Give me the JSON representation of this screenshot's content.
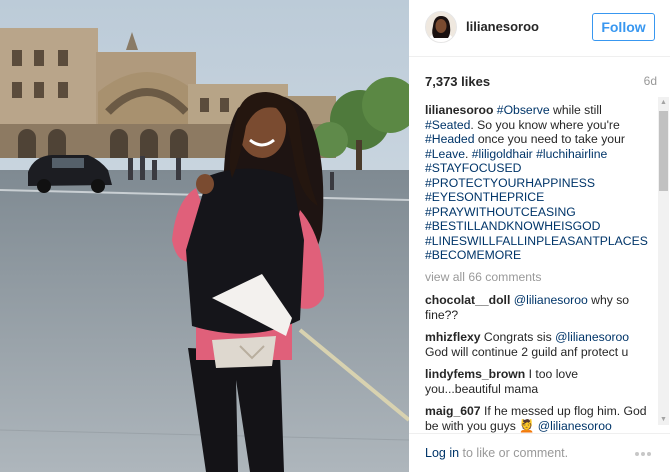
{
  "post": {
    "username": "lilianesoroo",
    "follow_label": "Follow",
    "likes": "7,373 likes",
    "time": "6d",
    "caption": {
      "user": "lilianesoroo",
      "t1": "#Observe",
      "t2": " while still ",
      "t3": "#Seated",
      "t4": ". So you know where you're ",
      "t5": "#Headed",
      "t6": " once you need to take your ",
      "t7": "#Leave",
      "t8": ". ",
      "t9": "#liligoldhair",
      "t10": " ",
      "t11": "#luchihairline",
      "tags": [
        "#STAYFOCUSED",
        "#PROTECTYOURHAPPINESS",
        "#EYESONTHEPRICE",
        "#PRAYWITHOUTCEASING",
        "#BESTILLANDKNOWHEISGOD",
        "#LINESWILLFALLINPLEASANTPLACES",
        "#BECOMEMORE"
      ]
    },
    "view_all": "view all 66 comments",
    "comments": [
      {
        "user": "chocolat__doll",
        "mention": "@lilianesoroo",
        "text": " why so fine??"
      },
      {
        "user": "mhizflexy",
        "pre": " Congrats sis ",
        "mention": "@lilianesoroo",
        "text": " God will continue 2 guild anf protect u"
      },
      {
        "user": "lindyfems_brown",
        "text": " I too love you...beautiful mama"
      },
      {
        "user": "maig_607",
        "text": " If he messed up flog him. God be with you guys ",
        "emoji": "💆",
        "mention": "@lilianesoroo"
      }
    ],
    "footer": {
      "login": "Log in",
      "rest": " to like or comment."
    }
  },
  "icons": {
    "more": "more-options-icon",
    "scroll_up": "scroll-up-arrow-icon",
    "scroll_down": "scroll-down-arrow-icon"
  },
  "colors": {
    "accent": "#3897f0",
    "link": "#003569",
    "muted": "#999999"
  }
}
